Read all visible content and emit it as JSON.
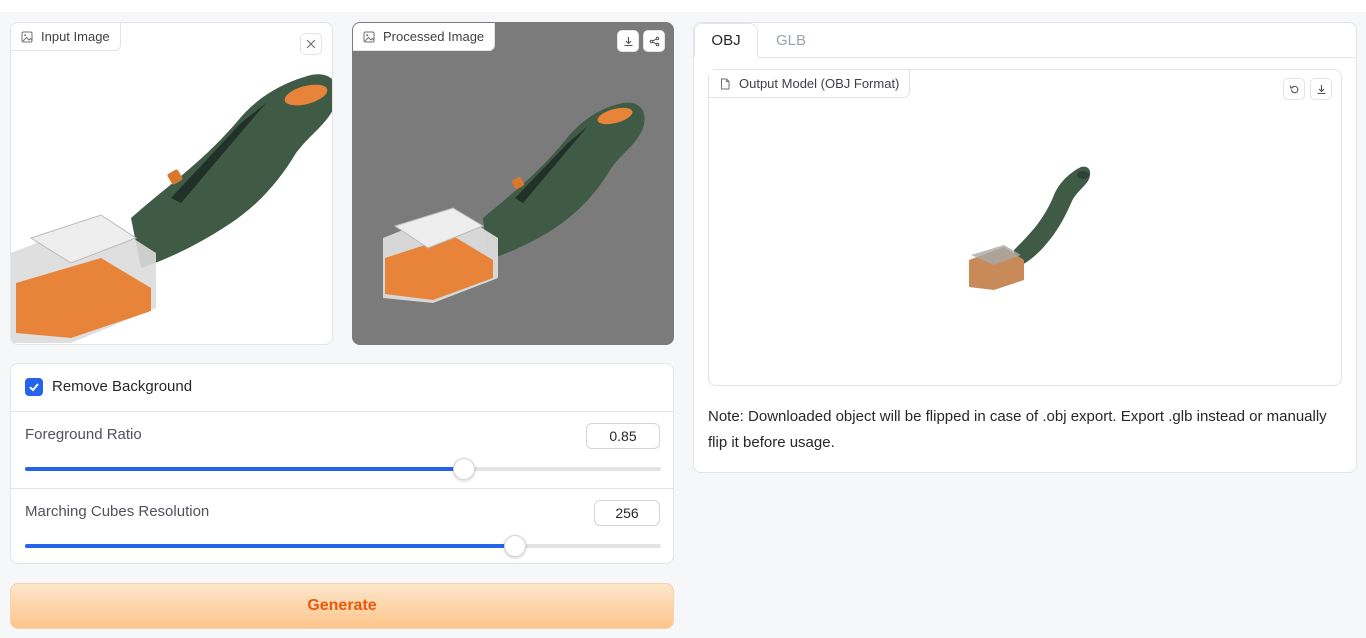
{
  "input_panel": {
    "label": "Input Image",
    "label_icon": "image-icon",
    "clear_icon": "close-icon"
  },
  "processed_panel": {
    "label": "Processed Image",
    "label_icon": "image-icon",
    "actions": [
      "download-icon",
      "share-icon"
    ],
    "background_color": "#7b7b7b"
  },
  "controls": {
    "remove_background": {
      "label": "Remove Background",
      "checked": true
    },
    "foreground_ratio": {
      "label": "Foreground Ratio",
      "value": "0.85",
      "fill_fraction": 0.69
    },
    "marching_cubes": {
      "label": "Marching Cubes Resolution",
      "value": "256",
      "fill_fraction": 0.77
    }
  },
  "generate_button": {
    "label": "Generate"
  },
  "output": {
    "tabs": [
      {
        "label": "OBJ",
        "active": true
      },
      {
        "label": "GLB",
        "active": false
      }
    ],
    "model_label": "Output Model (OBJ Format)",
    "model_icon": "file-icon",
    "model_actions": [
      "reset-icon",
      "download-icon"
    ],
    "note": "Note: Downloaded object will be flipped in case of .obj export. Export .glb instead or manually flip it before usage."
  },
  "colors": {
    "accent": "#2563eb",
    "generate_text": "#ea580c",
    "product_green": "#3f5a45",
    "product_orange": "#e8843a"
  }
}
